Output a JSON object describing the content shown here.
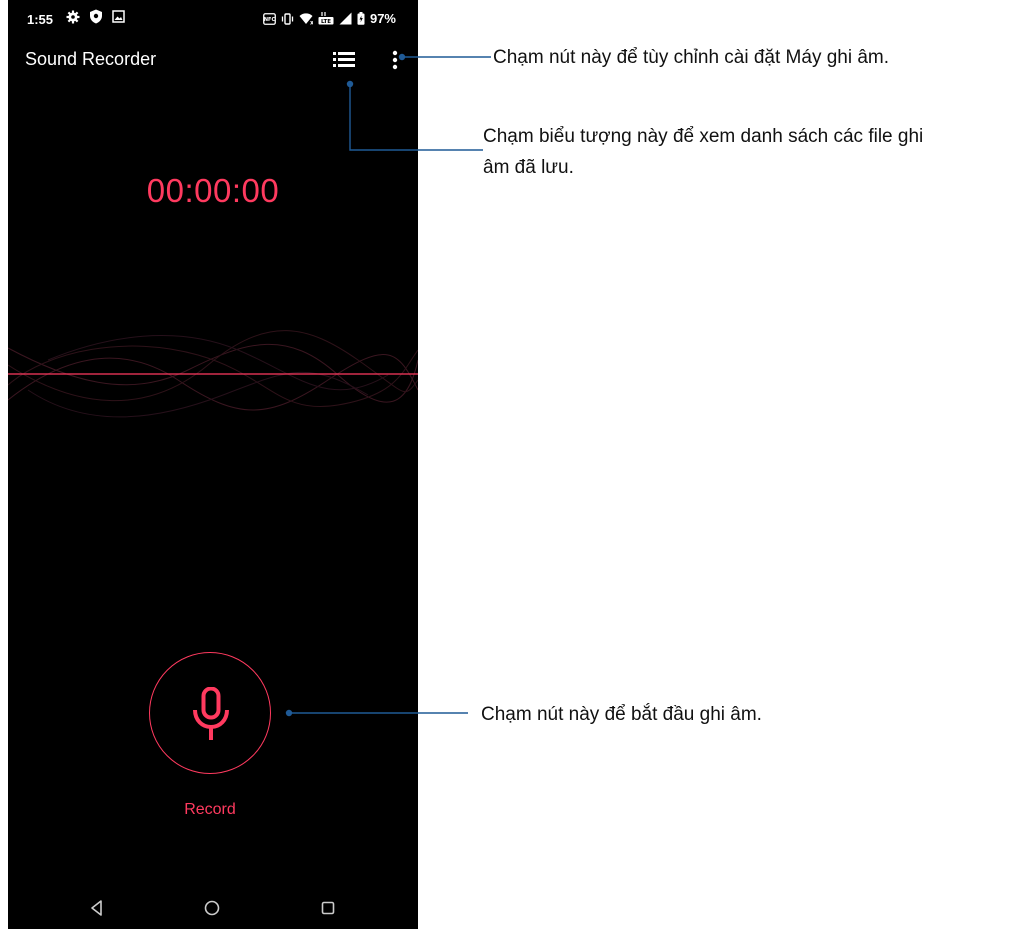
{
  "status_bar": {
    "time": "1:55",
    "battery": "97%",
    "icons_left": [
      "gear-icon",
      "shield-icon",
      "image-icon"
    ],
    "icons_right": [
      "nfc-icon",
      "vibrate-icon",
      "wifi-icon",
      "lte-icon",
      "signal-icon",
      "battery-icon"
    ]
  },
  "app_bar": {
    "title": "Sound Recorder",
    "list_icon": "list-icon",
    "menu_icon": "more-vert-icon"
  },
  "recorder": {
    "timer": "00:00:00",
    "record_label": "Record",
    "mic_icon": "microphone-icon"
  },
  "nav_bar": {
    "back_icon": "back-triangle-icon",
    "home_icon": "home-circle-icon",
    "recents_icon": "recents-square-icon"
  },
  "callouts": {
    "settings": "Chạm nút này để tùy chỉnh cài đặt Máy ghi âm.",
    "list_line1": "Chạm biểu tượng này để xem danh sách các file ghi",
    "list_line2": "âm đã lưu.",
    "record": "Chạm nút này để bắt đầu ghi âm."
  },
  "colors": {
    "accent": "#ff3a5f",
    "callout_line": "#1f5a96",
    "screen_bg": "#000000"
  }
}
